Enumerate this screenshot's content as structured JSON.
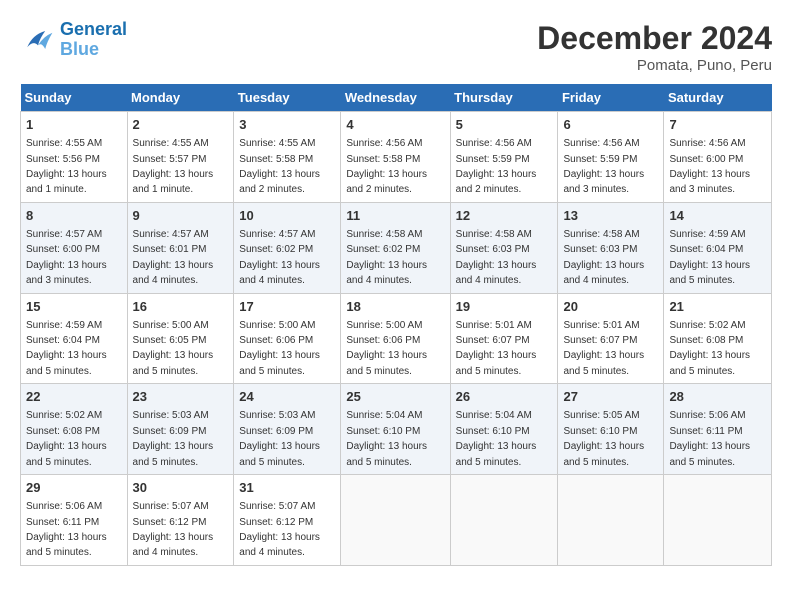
{
  "header": {
    "logo_line1": "General",
    "logo_line2": "Blue",
    "month_title": "December 2024",
    "location": "Pomata, Puno, Peru"
  },
  "days_of_week": [
    "Sunday",
    "Monday",
    "Tuesday",
    "Wednesday",
    "Thursday",
    "Friday",
    "Saturday"
  ],
  "weeks": [
    [
      {
        "day": "1",
        "sunrise": "4:55 AM",
        "sunset": "5:56 PM",
        "daylight": "13 hours and 1 minute."
      },
      {
        "day": "2",
        "sunrise": "4:55 AM",
        "sunset": "5:57 PM",
        "daylight": "13 hours and 1 minute."
      },
      {
        "day": "3",
        "sunrise": "4:55 AM",
        "sunset": "5:58 PM",
        "daylight": "13 hours and 2 minutes."
      },
      {
        "day": "4",
        "sunrise": "4:56 AM",
        "sunset": "5:58 PM",
        "daylight": "13 hours and 2 minutes."
      },
      {
        "day": "5",
        "sunrise": "4:56 AM",
        "sunset": "5:59 PM",
        "daylight": "13 hours and 2 minutes."
      },
      {
        "day": "6",
        "sunrise": "4:56 AM",
        "sunset": "5:59 PM",
        "daylight": "13 hours and 3 minutes."
      },
      {
        "day": "7",
        "sunrise": "4:56 AM",
        "sunset": "6:00 PM",
        "daylight": "13 hours and 3 minutes."
      }
    ],
    [
      {
        "day": "8",
        "sunrise": "4:57 AM",
        "sunset": "6:00 PM",
        "daylight": "13 hours and 3 minutes."
      },
      {
        "day": "9",
        "sunrise": "4:57 AM",
        "sunset": "6:01 PM",
        "daylight": "13 hours and 4 minutes."
      },
      {
        "day": "10",
        "sunrise": "4:57 AM",
        "sunset": "6:02 PM",
        "daylight": "13 hours and 4 minutes."
      },
      {
        "day": "11",
        "sunrise": "4:58 AM",
        "sunset": "6:02 PM",
        "daylight": "13 hours and 4 minutes."
      },
      {
        "day": "12",
        "sunrise": "4:58 AM",
        "sunset": "6:03 PM",
        "daylight": "13 hours and 4 minutes."
      },
      {
        "day": "13",
        "sunrise": "4:58 AM",
        "sunset": "6:03 PM",
        "daylight": "13 hours and 4 minutes."
      },
      {
        "day": "14",
        "sunrise": "4:59 AM",
        "sunset": "6:04 PM",
        "daylight": "13 hours and 5 minutes."
      }
    ],
    [
      {
        "day": "15",
        "sunrise": "4:59 AM",
        "sunset": "6:04 PM",
        "daylight": "13 hours and 5 minutes."
      },
      {
        "day": "16",
        "sunrise": "5:00 AM",
        "sunset": "6:05 PM",
        "daylight": "13 hours and 5 minutes."
      },
      {
        "day": "17",
        "sunrise": "5:00 AM",
        "sunset": "6:06 PM",
        "daylight": "13 hours and 5 minutes."
      },
      {
        "day": "18",
        "sunrise": "5:00 AM",
        "sunset": "6:06 PM",
        "daylight": "13 hours and 5 minutes."
      },
      {
        "day": "19",
        "sunrise": "5:01 AM",
        "sunset": "6:07 PM",
        "daylight": "13 hours and 5 minutes."
      },
      {
        "day": "20",
        "sunrise": "5:01 AM",
        "sunset": "6:07 PM",
        "daylight": "13 hours and 5 minutes."
      },
      {
        "day": "21",
        "sunrise": "5:02 AM",
        "sunset": "6:08 PM",
        "daylight": "13 hours and 5 minutes."
      }
    ],
    [
      {
        "day": "22",
        "sunrise": "5:02 AM",
        "sunset": "6:08 PM",
        "daylight": "13 hours and 5 minutes."
      },
      {
        "day": "23",
        "sunrise": "5:03 AM",
        "sunset": "6:09 PM",
        "daylight": "13 hours and 5 minutes."
      },
      {
        "day": "24",
        "sunrise": "5:03 AM",
        "sunset": "6:09 PM",
        "daylight": "13 hours and 5 minutes."
      },
      {
        "day": "25",
        "sunrise": "5:04 AM",
        "sunset": "6:10 PM",
        "daylight": "13 hours and 5 minutes."
      },
      {
        "day": "26",
        "sunrise": "5:04 AM",
        "sunset": "6:10 PM",
        "daylight": "13 hours and 5 minutes."
      },
      {
        "day": "27",
        "sunrise": "5:05 AM",
        "sunset": "6:10 PM",
        "daylight": "13 hours and 5 minutes."
      },
      {
        "day": "28",
        "sunrise": "5:06 AM",
        "sunset": "6:11 PM",
        "daylight": "13 hours and 5 minutes."
      }
    ],
    [
      {
        "day": "29",
        "sunrise": "5:06 AM",
        "sunset": "6:11 PM",
        "daylight": "13 hours and 5 minutes."
      },
      {
        "day": "30",
        "sunrise": "5:07 AM",
        "sunset": "6:12 PM",
        "daylight": "13 hours and 4 minutes."
      },
      {
        "day": "31",
        "sunrise": "5:07 AM",
        "sunset": "6:12 PM",
        "daylight": "13 hours and 4 minutes."
      },
      null,
      null,
      null,
      null
    ]
  ]
}
